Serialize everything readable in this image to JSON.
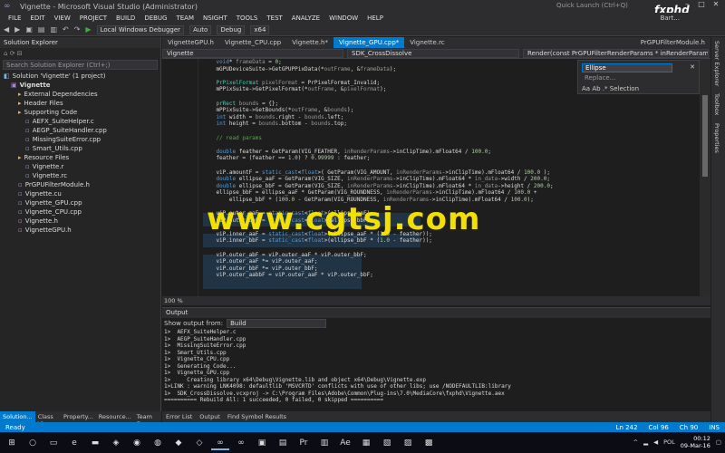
{
  "window": {
    "title": "Vignette - Microsoft Visual Studio (Administrator)",
    "quick_launch": "Quick Launch (Ctrl+Q)",
    "user": "Bart..."
  },
  "menu": [
    "FILE",
    "EDIT",
    "VIEW",
    "PROJECT",
    "BUILD",
    "DEBUG",
    "TEAM",
    "NSIGHT",
    "TOOLS",
    "TEST",
    "ANALYZE",
    "WINDOW",
    "HELP"
  ],
  "toolbar": {
    "debugger": "Local Windows Debugger",
    "config_auto": "Auto",
    "config": "Debug",
    "platform": "x64"
  },
  "solution_explorer": {
    "title": "Solution Explorer",
    "search_placeholder": "Search Solution Explorer (Ctrl+;)",
    "items": [
      {
        "label": "Solution 'Vignette' (1 project)",
        "icon": "sol",
        "indent": 0
      },
      {
        "label": "Vignette",
        "icon": "proj",
        "indent": 1,
        "bold": true
      },
      {
        "label": "External Dependencies",
        "icon": "folder",
        "indent": 2
      },
      {
        "label": "Header Files",
        "icon": "folder",
        "indent": 2
      },
      {
        "label": "Supporting Code",
        "icon": "folder",
        "indent": 2
      },
      {
        "label": "AEFX_SuiteHelper.c",
        "icon": "cpp",
        "indent": 3
      },
      {
        "label": "AEGP_SuiteHandler.cpp",
        "icon": "cpp",
        "indent": 3
      },
      {
        "label": "MissingSuiteError.cpp",
        "icon": "cpp",
        "indent": 3
      },
      {
        "label": "Smart_Utils.cpp",
        "icon": "cpp",
        "indent": 3
      },
      {
        "label": "Resource Files",
        "icon": "folder",
        "indent": 2
      },
      {
        "label": "Vignette.r",
        "icon": "cpp",
        "indent": 3
      },
      {
        "label": "Vignette.rc",
        "icon": "cpp",
        "indent": 3
      },
      {
        "label": "PrGPUFilterModule.h",
        "icon": "h",
        "indent": 2
      },
      {
        "label": "Vignette.cu",
        "icon": "cpp",
        "indent": 2
      },
      {
        "label": "Vignette_GPU.cpp",
        "icon": "cpp",
        "indent": 2
      },
      {
        "label": "Vignette_CPU.cpp",
        "icon": "cpp",
        "indent": 2
      },
      {
        "label": "Vignette.h",
        "icon": "h",
        "indent": 2
      },
      {
        "label": "VignetteGPU.h",
        "icon": "h",
        "indent": 2
      }
    ]
  },
  "doc_tabs": [
    {
      "label": "VignetteGPU.h",
      "active": false
    },
    {
      "label": "Vignette_CPU.cpp",
      "active": false
    },
    {
      "label": "Vignette.h*",
      "active": false
    },
    {
      "label": "Vignette_GPU.cpp*",
      "active": true
    },
    {
      "label": "Vignette.rc",
      "active": false
    }
  ],
  "doc_tab_right": "PrGPUFilterModule.h",
  "nav": {
    "project": "Vignette",
    "scope": "SDK_CrossDissolve",
    "member": "Render(const PrGPUFilterRenderParams * inRenderParams, const PPix"
  },
  "find": {
    "value": "Ellipse",
    "replace_placeholder": "Replace...",
    "scope": "Selection"
  },
  "code_lines": [
    "    void* frameData = 0;",
    "    mGPUDeviceSuite->GetGPUPPixData(*outFrame, &frameData);",
    "",
    "    PrPixelFormat pixelFormat = PrPixelFormat_Invalid;",
    "    mPPixSuite->GetPixelFormat(*outFrame, &pixelFormat);",
    "",
    "    prRect bounds = {};",
    "    mPPixSuite->GetBounds(*outFrame, &bounds);",
    "    int width = bounds.right - bounds.left;",
    "    int height = bounds.bottom - bounds.top;",
    "",
    "    // read params",
    "",
    "    double feather = GetParam(VIG_FEATHER, inRenderParams->inClipTime).mFloat64 / 100.0;",
    "    feather = (feather == 1.0) ? 0.99999 : feather;",
    "",
    "    viP.amountF = static_cast<float>( GetParam(VIG_AMOUNT, inRenderParams->inClipTime).mFloat64 / 100.0 );",
    "    double ellipse_aaF = GetParam(VIG_SIZE, inRenderParams->inClipTime).mFloat64 * in_data->width / 200.0;",
    "    double ellipse_bbF = GetParam(VIG_SIZE, inRenderParams->inClipTime).mFloat64 * in_data->height / 200.0;",
    "    ellipse_bbF = ellipse_aaF * GetParam(VIG_ROUNDNESS, inRenderParams->inClipTime).mFloat64 / 100.0 +",
    "        ellipse_bbF * (100.0 - GetParam(VIG_ROUNDNESS, inRenderParams->inClipTime).mFloat64 / 100.0);",
    "",
    "    viP.outer_aaF = static_cast<float>(ellipse_aaF);",
    "    viP.outer_bbF = static_cast<float>(ellipse_bbF);",
    "",
    "    viP.inner_aaF = static_cast<float>(ellipse_aaF * (1.0 - feather));",
    "    viP.inner_bbF = static_cast<float>(ellipse_bbF * (1.0 - feather));",
    "",
    "    viP.outer_abF = viP.outer_aaF * viP.outer_bbF;",
    "    viP.outer_aaF *= viP.outer_aaF;",
    "    viP.outer_bbF *= viP.outer_bbF;",
    "    viP.outer_aabbF = viP.outer_aaF * viP.outer_bbF;"
  ],
  "zoom": "100 %",
  "output": {
    "title": "Output",
    "show_from_label": "Show output from:",
    "show_from_value": "Build",
    "lines": [
      "1>  AEFX_SuiteHelper.c",
      "1>  AEGP_SuiteHandler.cpp",
      "1>  MissingSuiteError.cpp",
      "1>  Smart_Utils.cpp",
      "1>  Vignette_CPU.cpp",
      "1>  Generating Code...",
      "1>  Vignette_GPU.cpp",
      "1>     Creating library x64\\Debug\\Vignette.lib and object x64\\Debug\\Vignette.exp",
      "1>LINK : warning LNK4098: defaultlib 'MSVCRTD' conflicts with use of other libs; use /NODEFAULTLIB:library",
      "1>  SDK_CrossDissolve.vcxproj -> C:\\Program Files\\Adobe\\Common\\Plug-ins\\7.0\\MediaCore\\fxphd\\Vignette.aex",
      "========== Rebuild All: 1 succeeded, 0 failed, 0 skipped =========="
    ]
  },
  "bottom_tabs_left": [
    "Solution...",
    "Class View",
    "Property...",
    "Resource...",
    "Team Exp..."
  ],
  "bottom_tabs_output": [
    "Error List",
    "Output",
    "Find Symbol Results"
  ],
  "side_tabs": [
    "Server Explorer",
    "Toolbox",
    "Properties"
  ],
  "status": {
    "ready": "Ready",
    "ln": "Ln 242",
    "col": "Col 96",
    "ch": "Ch 90",
    "ins": "INS"
  },
  "taskbar": {
    "lang": "POL",
    "time": "00:12",
    "date": "09-Mar-16"
  },
  "watermark": "www.cgtsj.com",
  "logo": "fxphd"
}
